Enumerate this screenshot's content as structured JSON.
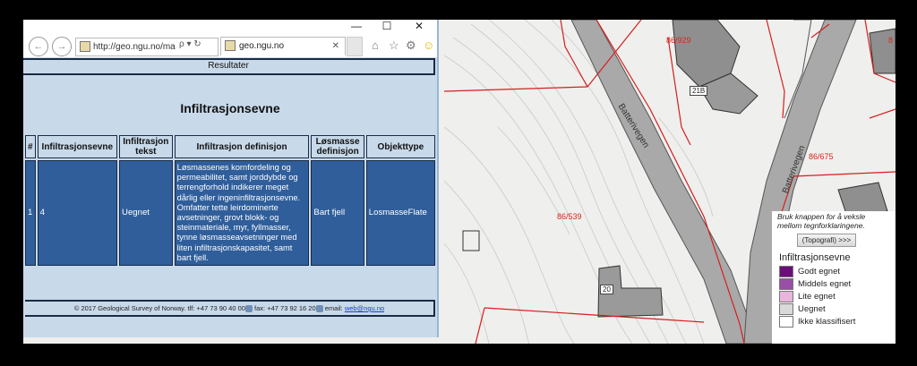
{
  "browser": {
    "url": "http://geo.ngu.no/ma",
    "tab_title": "geo.ngu.no",
    "back": "←",
    "forward": "→",
    "window_controls": {
      "minimize": "—",
      "maximize": "☐",
      "close": "✕"
    },
    "tab_close": "✕",
    "url_tools": "ρ ▾ ↻",
    "toolbar_icons": {
      "home": "⌂",
      "favorites": "☆",
      "settings": "⚙",
      "smiley": "☺"
    }
  },
  "page": {
    "results_header": "Resultater",
    "title": "Infiltrasjonsevne",
    "table": {
      "columns": [
        "#",
        "Infiltrasjonsevne",
        "Infiltrasjon tekst",
        "Infiltrasjon definisjon",
        "Løsmasse definisjon",
        "Objekttype"
      ],
      "rows": [
        {
          "num": "1",
          "infiltrasjonsevne": "4",
          "tekst": "Uegnet",
          "definisjon": "Løsmassenes kornfordeling og permeabilitet, samt jorddybde og terrengforhold indikerer meget dårlig eller ingeninfiltrasjonsevne. Omfatter tette leirdominerte avsetninger, grovt blokk- og steinmateriale, myr, fyllmasser, tynne løsmasseavsetninger med liten infiltrasjonskapasitet, samt bart fjell.",
          "losmasse": "Bart fjell",
          "objekttype": "LosmasseFlate"
        }
      ]
    },
    "footer": {
      "copyright": "© 2017 Geological Survey of Norway. tlf: +47 73 90 40 00",
      "fax": " fax: +47 73 92 16 20",
      "email_label": " email: ",
      "email": "web@ngu.no"
    }
  },
  "map": {
    "labels": {
      "plot1": "86/929",
      "plot2": "86/675",
      "plot3": "86/539",
      "plot4": "8",
      "house1": "21B",
      "house2": "20",
      "road1": "Batterivegen",
      "road2": "Batterivegen"
    }
  },
  "legend": {
    "hint": "Bruk knappen for å veksle mellom tegnforklaringene.",
    "toggle_button": "(Topografi) >>>",
    "title": "Infiltrasjonsevne",
    "items": [
      {
        "label": "Godt egnet",
        "color": "#6a0f7a"
      },
      {
        "label": "Middels egnet",
        "color": "#9a4fa6"
      },
      {
        "label": "Lite egnet",
        "color": "#e8b6dc"
      },
      {
        "label": "Uegnet",
        "color": "#d9d9d9"
      },
      {
        "label": "Ikke klassifisert",
        "color": "#ffffff"
      }
    ]
  }
}
